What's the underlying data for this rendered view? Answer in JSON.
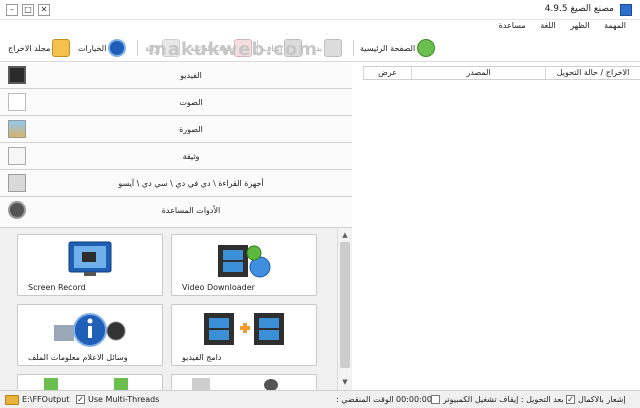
{
  "window": {
    "title": "مصنع الصيغ 4.9.5",
    "minimize": "–",
    "maximize": "□",
    "close": "✕"
  },
  "menu": [
    "المهمة",
    "الظهر",
    "اللغة",
    "مساعدة"
  ],
  "toolbar": {
    "items": [
      {
        "label": "مجلد الاخراج",
        "icon": "output-folder-icon",
        "enabled": true
      },
      {
        "label": "الخيارات",
        "icon": "options-icon",
        "enabled": true
      },
      {
        "label": "إزالة",
        "icon": "remove-icon",
        "enabled": false
      },
      {
        "label": "حذف القائمة",
        "icon": "clear-list-icon",
        "enabled": false
      },
      {
        "label": "إيقاف",
        "icon": "stop-icon",
        "enabled": false
      },
      {
        "label": "بدء",
        "icon": "start-icon",
        "enabled": false
      },
      {
        "label": "الصفحة الرئيسية",
        "icon": "homepage-icon",
        "enabled": true
      }
    ],
    "watermark": "makukweb.com"
  },
  "categories": [
    {
      "label": "الفيديو",
      "icon": "video-icon"
    },
    {
      "label": "الصوت",
      "icon": "audio-icon"
    },
    {
      "label": "الصورة",
      "icon": "picture-icon"
    },
    {
      "label": "وثيقة",
      "icon": "document-icon"
    },
    {
      "label": "أجهزة القراءة \\ دي في دي \\ سي دي \\ آيسو",
      "icon": "disc-icon"
    },
    {
      "label": "الأدوات المساعدة",
      "icon": "utilities-icon"
    }
  ],
  "tools": [
    {
      "label": "Screen Record",
      "icon": "screen-record-icon"
    },
    {
      "label": "Video Downloader",
      "icon": "video-downloader-icon"
    },
    {
      "label": "وسائل الاعلام معلومات الملف",
      "icon": "media-info-icon"
    },
    {
      "label": "دامج الفيديو",
      "icon": "video-joiner-icon"
    }
  ],
  "list": {
    "columns": [
      "عرض",
      "المصدر",
      "الاخراج / حالة التحويل"
    ]
  },
  "status": {
    "output_path": "E:\\FFOutput",
    "multithread": "Use Multi-Threads",
    "elapsed_label": "الوقت المنقضي :",
    "elapsed_value": "00:00:00",
    "after_convert": "بعد التحويل : إيقاف تشغيل الكمبيوتر",
    "notify": "إشعار بالاكمال"
  },
  "colors": {
    "accent": "#2b6fcf",
    "toolbar_disabled": "#a0a0a0",
    "panel_bg": "#f0f0f0"
  }
}
